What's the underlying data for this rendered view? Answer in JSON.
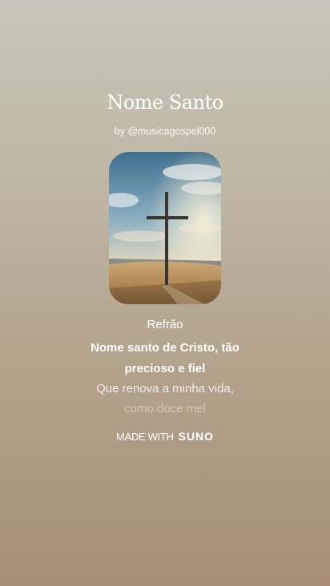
{
  "song": {
    "title": "Nome Santo",
    "byline": "by @musicagospel000"
  },
  "lyrics": {
    "section": "Refrão",
    "active_line": "Nome santo de Cristo, tão precioso e fiel",
    "next_line": "Que renova a minha vida,",
    "faded_line": "como doce mel"
  },
  "footer": {
    "made_with": "MADE WITH",
    "brand": "SUNO"
  },
  "cover": {
    "image_icon": "cross-on-hill-image"
  }
}
